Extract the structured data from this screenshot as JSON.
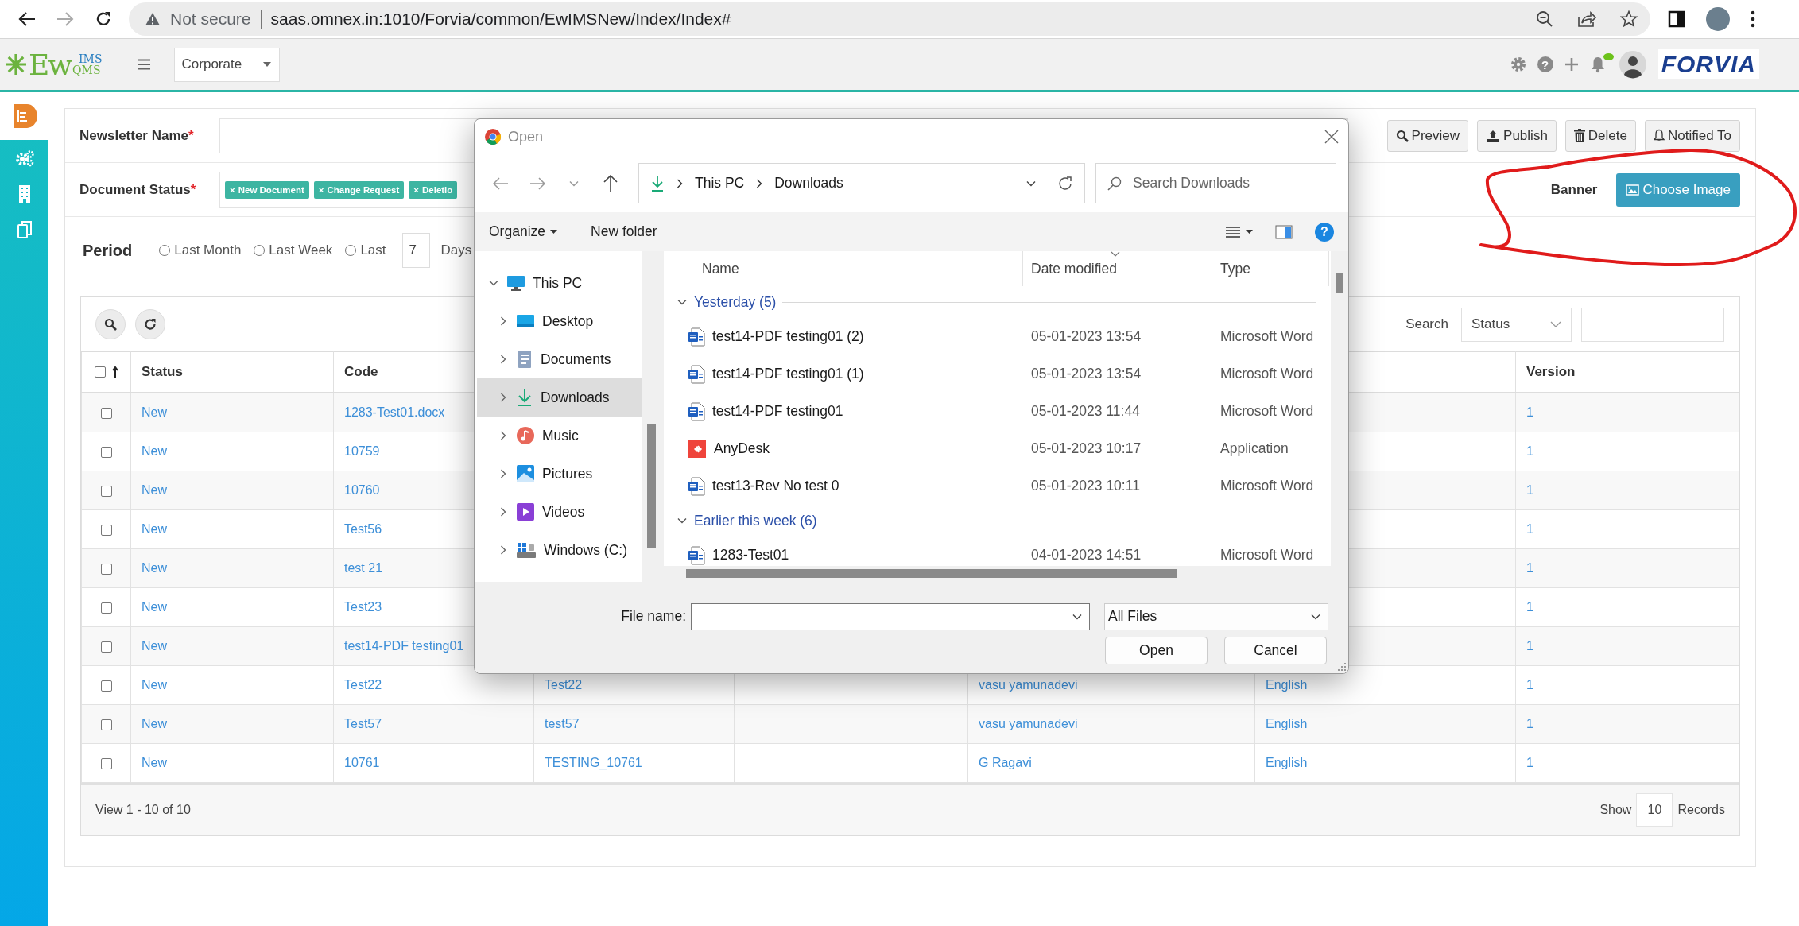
{
  "browser": {
    "security_label": "Not secure",
    "url": "saas.omnex.in:1010/Forvia/common/EwIMSNew/Index/Index#",
    "forward_disabled": true
  },
  "app_header": {
    "logo": {
      "main": "Ew",
      "top": "IMS",
      "bottom": "QMS"
    },
    "site_select": "Corporate",
    "help_glyph": "?",
    "notification_dot": true,
    "brand": "FORVIA"
  },
  "sidebar": {
    "items": [
      {
        "kind": "document",
        "selected": true
      },
      {
        "kind": "gears",
        "selected": false
      },
      {
        "kind": "building",
        "selected": false
      },
      {
        "kind": "copy",
        "selected": false
      }
    ]
  },
  "newsletter": {
    "label": "Newsletter Name",
    "mark": "*"
  },
  "actions": [
    {
      "kind": "search",
      "label": "Preview"
    },
    {
      "kind": "upload",
      "label": "Publish"
    },
    {
      "kind": "trash",
      "label": "Delete"
    },
    {
      "kind": "bell",
      "label": "Notified To"
    }
  ],
  "document_status": {
    "label": "Document Status",
    "mark": "*",
    "tags": [
      {
        "remove": "×",
        "label": "New Document"
      },
      {
        "remove": "×",
        "label": "Change Request"
      },
      {
        "remove": "×",
        "label": "Deletio"
      }
    ]
  },
  "banner": {
    "label": "Banner",
    "button": "Choose Image"
  },
  "period": {
    "label": "Period",
    "options": [
      {
        "label": "Last Month",
        "selected": false
      },
      {
        "label": "Last Week",
        "selected": false
      },
      {
        "label": "Last",
        "selected": false,
        "days": "7",
        "unit": "Days"
      }
    ]
  },
  "grid": {
    "search_label": "Search",
    "search_field": "Status",
    "header_checked": false,
    "columns": {
      "status": "Status",
      "code": "Code",
      "version": "Version"
    },
    "rows": [
      {
        "checked": false,
        "status": "New",
        "code": "1283-Test01.docx",
        "version": "1"
      },
      {
        "checked": false,
        "status": "New",
        "code": "10759",
        "version": "1"
      },
      {
        "checked": false,
        "status": "New",
        "code": "10760",
        "version": "1"
      },
      {
        "checked": false,
        "status": "New",
        "code": "Test56",
        "version": "1"
      },
      {
        "checked": false,
        "status": "New",
        "code": "test 21",
        "version": "1"
      },
      {
        "checked": false,
        "status": "New",
        "code": "Test23",
        "version": "1"
      },
      {
        "checked": false,
        "status": "New",
        "code": "test14-PDF testing01",
        "version": "1"
      },
      {
        "checked": false,
        "status": "New",
        "code": "Test22",
        "column_3": "Test22",
        "column_5": "vasu yamunadevi",
        "column_6": "English",
        "version": "1"
      },
      {
        "checked": false,
        "status": "New",
        "code": "Test57",
        "column_3": "test57",
        "column_5": "vasu yamunadevi",
        "column_6": "English",
        "version": "1"
      },
      {
        "checked": false,
        "status": "New",
        "code": "10761",
        "column_3": "TESTING_10761",
        "column_5": "G Ragavi",
        "column_6": "English",
        "version": "1"
      }
    ],
    "footer": {
      "summary": "View 1 - 10 of 10",
      "show": "Show",
      "page_size": "10",
      "records": "Records"
    }
  },
  "dialog": {
    "title": "Open",
    "path": [
      "This PC",
      "Downloads"
    ],
    "search_placeholder": "Search Downloads",
    "commands": [
      {
        "label": "Organize",
        "dropdown": true
      },
      {
        "label": "New folder",
        "dropdown": false
      }
    ],
    "help_glyph": "?",
    "tree": [
      {
        "label": "This PC",
        "kind": "pc",
        "expanded": true,
        "selected": false,
        "children": [
          {
            "label": "Desktop",
            "kind": "desktop",
            "expanded": false,
            "selected": false
          },
          {
            "label": "Documents",
            "kind": "documents",
            "expanded": false,
            "selected": false
          },
          {
            "label": "Downloads",
            "kind": "downloads",
            "expanded": false,
            "selected": true
          },
          {
            "label": "Music",
            "kind": "music",
            "expanded": false,
            "selected": false
          },
          {
            "label": "Pictures",
            "kind": "pictures",
            "expanded": false,
            "selected": false
          },
          {
            "label": "Videos",
            "kind": "videos",
            "expanded": false,
            "selected": false
          },
          {
            "label": "Windows (C:)",
            "kind": "drive",
            "expanded": false,
            "selected": false
          }
        ]
      }
    ],
    "columns": [
      "Name",
      "Date modified",
      "Type"
    ],
    "groups": [
      {
        "label": "Yesterday (5)",
        "expanded": true,
        "files": [
          {
            "kind": "word",
            "name": "test14-PDF testing01 (2)",
            "date": "05-01-2023 13:54",
            "type": "Microsoft Word"
          },
          {
            "kind": "word",
            "name": "test14-PDF testing01 (1)",
            "date": "05-01-2023 13:54",
            "type": "Microsoft Word"
          },
          {
            "kind": "word",
            "name": "test14-PDF testing01",
            "date": "05-01-2023 11:44",
            "type": "Microsoft Word"
          },
          {
            "kind": "app",
            "name": "AnyDesk",
            "date": "05-01-2023 10:17",
            "type": "Application"
          },
          {
            "kind": "word",
            "name": "test13-Rev No test 0",
            "date": "05-01-2023 10:11",
            "type": "Microsoft Word"
          }
        ]
      },
      {
        "label": "Earlier this week (6)",
        "expanded": true,
        "files": [
          {
            "kind": "word",
            "name": "1283-Test01",
            "date": "04-01-2023 14:51",
            "type": "Microsoft Word"
          }
        ]
      }
    ],
    "file_name_label": "File name:",
    "filter": "All Files",
    "buttons": [
      "Open",
      "Cancel"
    ]
  },
  "annotation": {
    "kind": "freehand-circle"
  }
}
